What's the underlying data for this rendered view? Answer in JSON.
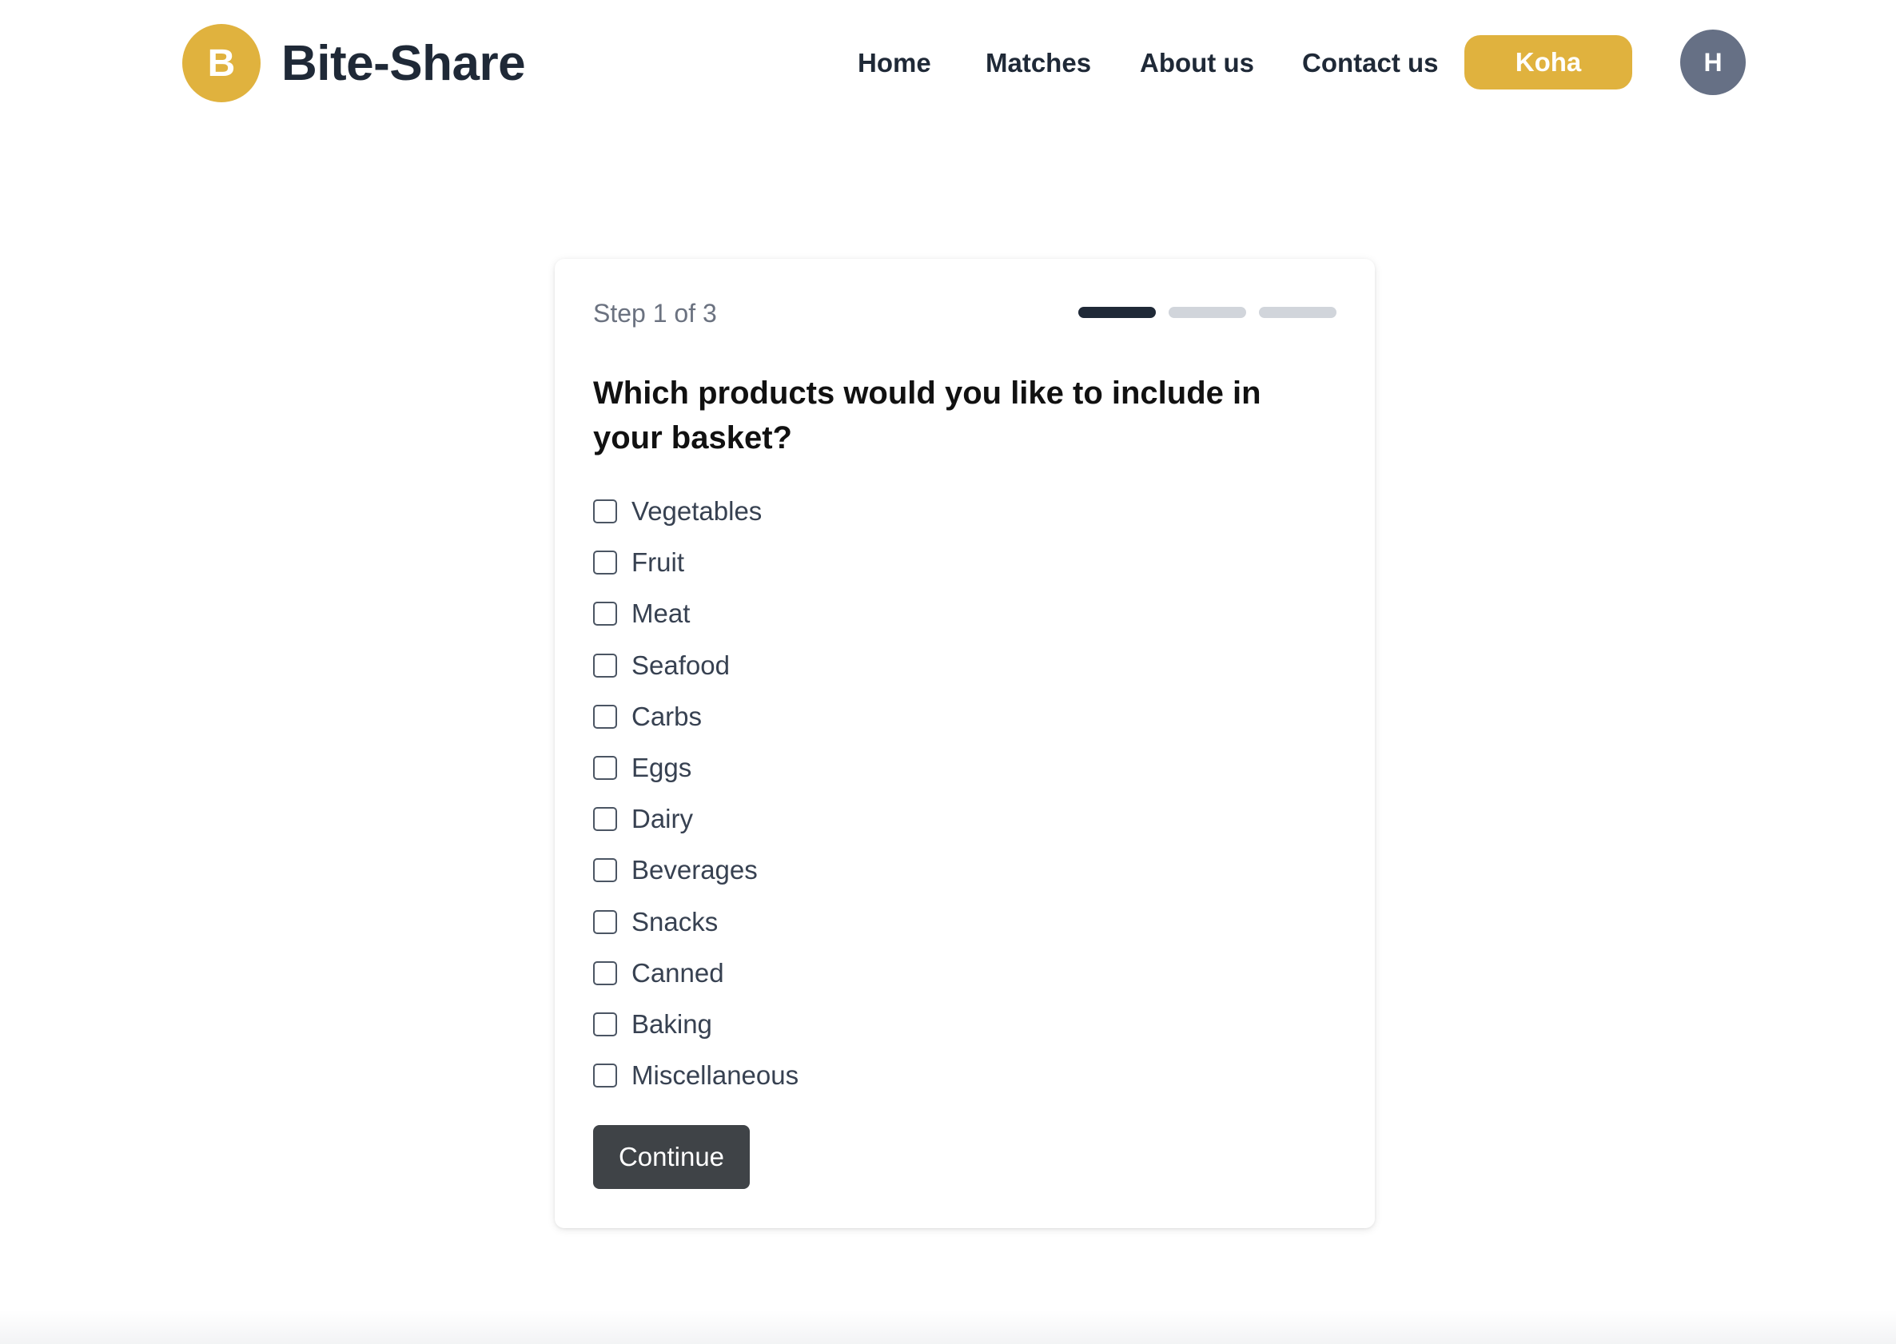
{
  "brand": {
    "logo_letter": "B",
    "name": "Bite-Share",
    "accent_color": "#e0b23e"
  },
  "nav": {
    "home": "Home",
    "matches": "Matches",
    "about": "About us",
    "contact": "Contact us",
    "koha": "Koha",
    "avatar_initial": "H"
  },
  "wizard": {
    "step_label": "Step 1 of 3",
    "current_step": 1,
    "total_steps": 3,
    "question": "Which products would you like to include in your basket?",
    "options": [
      {
        "label": "Vegetables",
        "checked": false
      },
      {
        "label": "Fruit",
        "checked": false
      },
      {
        "label": "Meat",
        "checked": false
      },
      {
        "label": "Seafood",
        "checked": false
      },
      {
        "label": "Carbs",
        "checked": false
      },
      {
        "label": "Eggs",
        "checked": false
      },
      {
        "label": "Dairy",
        "checked": false
      },
      {
        "label": "Beverages",
        "checked": false
      },
      {
        "label": "Snacks",
        "checked": false
      },
      {
        "label": "Canned",
        "checked": false
      },
      {
        "label": "Baking",
        "checked": false
      },
      {
        "label": "Miscellaneous",
        "checked": false
      }
    ],
    "continue_label": "Continue"
  }
}
